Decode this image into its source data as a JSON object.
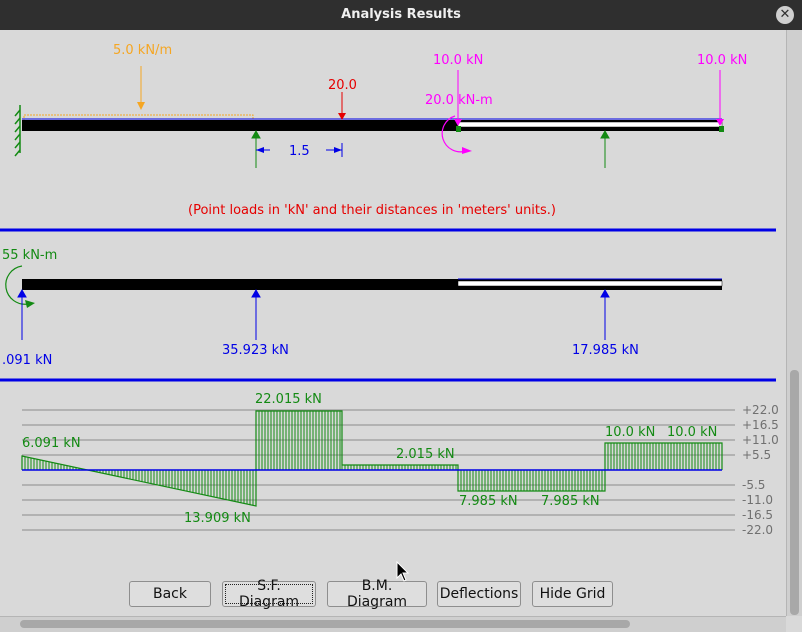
{
  "window": {
    "title": "Analysis Results",
    "close_glyph": "✕"
  },
  "load_diagram": {
    "udl_label": "5.0 kN/m",
    "point_load_1": "20.0",
    "point_load_2": "10.0 kN",
    "point_load_3": "10.0 kN",
    "moment_label": "20.0 kN-m",
    "dimension": "1.5",
    "note": "(Point loads in 'kN' and their distances in 'meters' units.)"
  },
  "reactions": {
    "moment": "55 kN-m",
    "r1": ".091 kN",
    "r2": "35.923 kN",
    "r3": "17.985 kN"
  },
  "shear_diagram": {
    "labels": [
      "6.091 kN",
      "13.909 kN",
      "22.015 kN",
      "2.015 kN",
      "7.985 kN",
      "7.985 kN",
      "10.0 kN",
      "10.0 kN"
    ],
    "grid_labels": [
      "+22.0",
      "+16.5",
      "+11.0",
      "+5.5",
      "-5.5",
      "-11.0",
      "-16.5",
      "-22.0"
    ]
  },
  "buttons": {
    "back": "Back",
    "sf": "S.F. Diagram",
    "bm": "B.M. Diagram",
    "deflections": "Deflections",
    "hide_grid": "Hide Grid"
  },
  "colors": {
    "orange": "#f5a623",
    "red": "#e60000",
    "magenta": "#ff00ff",
    "green": "#138a13",
    "blue": "#0000e6"
  }
}
